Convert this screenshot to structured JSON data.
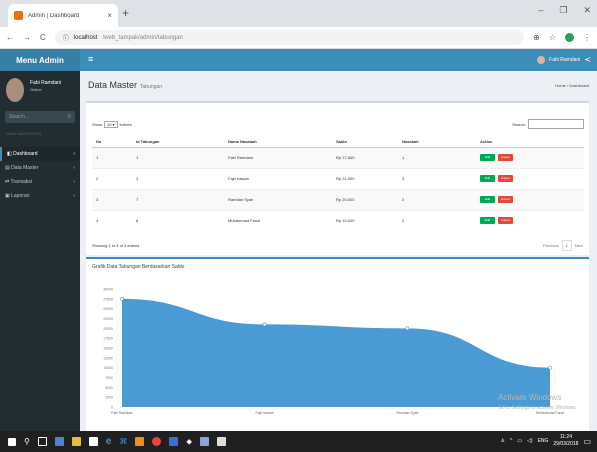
{
  "browser": {
    "tab_title": "Admin | Dashboard",
    "url_host": "localhost",
    "url_path": "/web_tampak/admin/tabungan"
  },
  "header": {
    "logo": "Menu Admin",
    "menu_icon": "≡",
    "user_name": "Fabi Ramdani"
  },
  "sidebar": {
    "user_name": "Fabi Ramdani",
    "user_status": "Online",
    "search_placeholder": "Search...",
    "section": "MAIN NAVIGATION",
    "items": [
      {
        "label": "Dashboard",
        "active": true
      },
      {
        "label": "Data Master",
        "active": false
      },
      {
        "label": "Transaksi",
        "active": false
      },
      {
        "label": "Laporan",
        "active": false
      }
    ]
  },
  "page": {
    "title": "Data Master",
    "subtitle": "Tabungan",
    "breadcrumb": "Home › Dashboard"
  },
  "table": {
    "show_label": "Show",
    "show_value": "10",
    "entries_label": "entries",
    "search_label": "Search:",
    "headers": [
      "No",
      "Id Tabungan",
      "Nama Nasabah",
      "Saldo",
      "Nasabah",
      "Action"
    ],
    "rows": [
      [
        "1",
        "1",
        "Fabi Ramdani",
        "Rp 27.500",
        "1"
      ],
      [
        "2",
        "3",
        "Fajri Irawan",
        "Rp 21.000",
        "3"
      ],
      [
        "3",
        "7",
        "Ramdan Syah",
        "Rp 20.000",
        "2"
      ],
      [
        "4",
        "8",
        "Muhammad Fauzi",
        "Rp 10.000",
        "2"
      ]
    ],
    "edit_label": "Edit",
    "delete_label": "Hapus",
    "info": "Showing 1 to 4 of 4 entries",
    "prev": "Previous",
    "page": "1",
    "next": "Next"
  },
  "chart_title": "Grafik Data Tabungan Berdasarkan Saldo",
  "chart_data": {
    "type": "area",
    "categories": [
      "Fabi Ramdani",
      "Fajri Irawan",
      "Ramdan Syah",
      "Muhammad Fauzi"
    ],
    "values": [
      27500,
      21000,
      20000,
      10000
    ],
    "yticks": [
      "30000",
      "27500",
      "25000",
      "22500",
      "20000",
      "17500",
      "15000",
      "12500",
      "10000",
      "7500",
      "5000",
      "2500",
      "0"
    ],
    "ylim": [
      0,
      30000
    ],
    "color": "#4a9bd4"
  },
  "watermark": {
    "title": "Activate Windows",
    "sub": "Go to Settings to activate Windows."
  },
  "taskbar": {
    "time": "11:24",
    "date": "29/03/2018",
    "lang": "ENG"
  }
}
